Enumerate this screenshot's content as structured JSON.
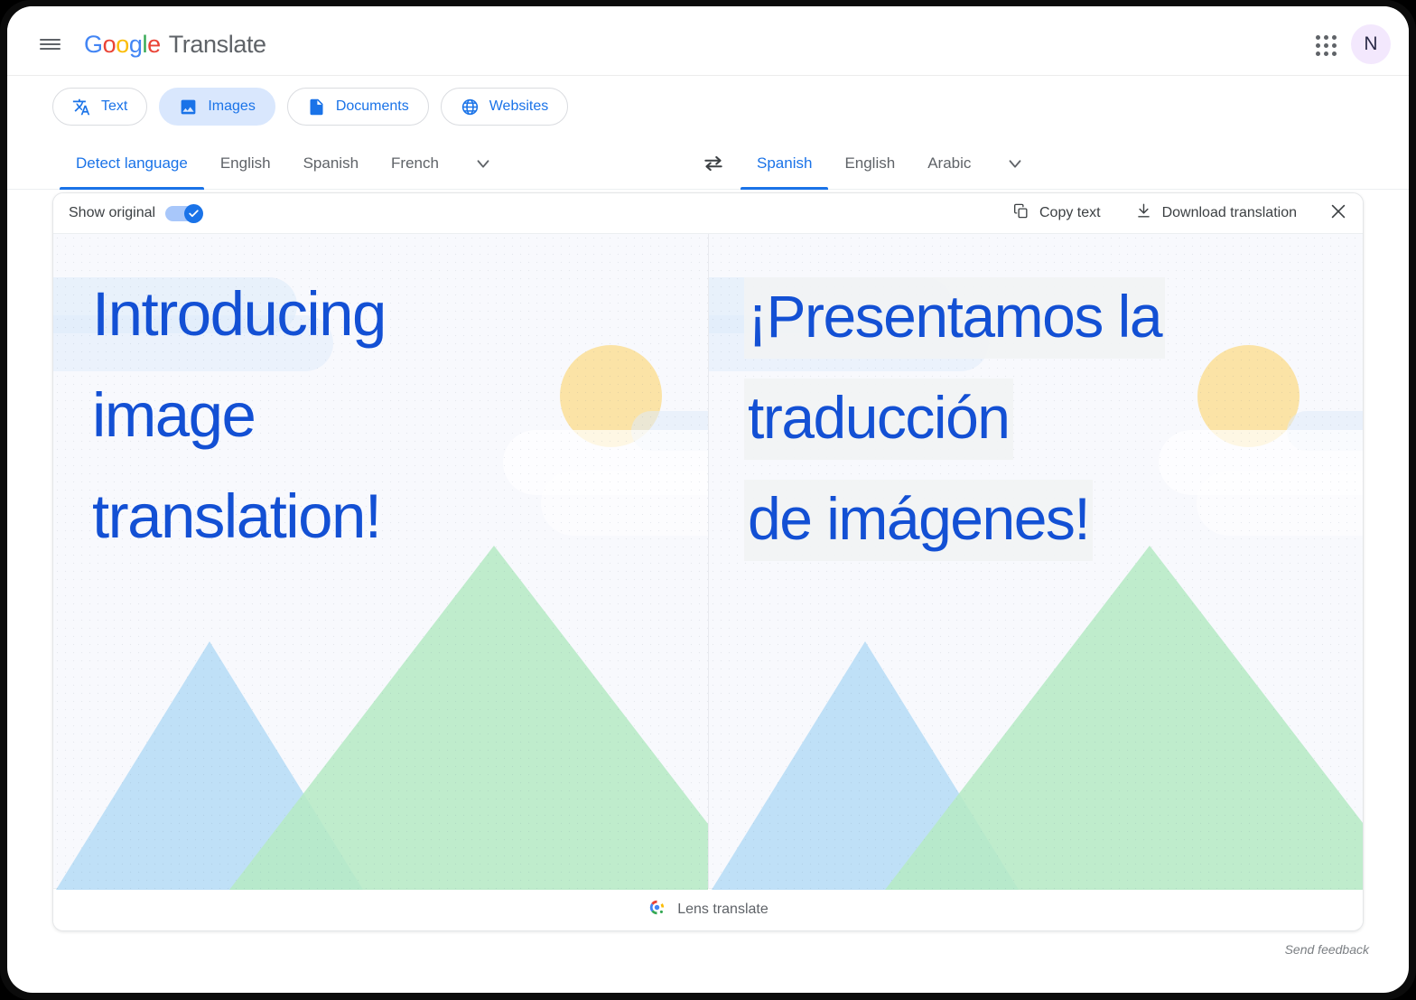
{
  "header": {
    "menu_icon": "hamburger-menu-icon",
    "brand_google": [
      "G",
      "o",
      "o",
      "g",
      "l",
      "e"
    ],
    "brand_product": "Translate",
    "apps_icon": "apps-grid-icon",
    "avatar_initial": "N"
  },
  "mode_tabs": [
    {
      "label": "Text",
      "icon": "translate-text-icon",
      "active": false
    },
    {
      "label": "Images",
      "icon": "image-icon",
      "active": true
    },
    {
      "label": "Documents",
      "icon": "document-icon",
      "active": false
    },
    {
      "label": "Websites",
      "icon": "globe-icon",
      "active": false
    }
  ],
  "source_languages": {
    "items": [
      "Detect language",
      "English",
      "Spanish",
      "French"
    ],
    "selected": "Detect language",
    "more_icon": "chevron-down-icon"
  },
  "swap": {
    "icon": "swap-languages-icon"
  },
  "target_languages": {
    "items": [
      "Spanish",
      "English",
      "Arabic"
    ],
    "selected": "Spanish",
    "more_icon": "chevron-down-icon"
  },
  "card_toolbar": {
    "show_original_label": "Show original",
    "show_original_on": true,
    "toggle_icon": "check-icon",
    "copy_text_label": "Copy text",
    "copy_text_icon": "copy-icon",
    "download_label": "Download translation",
    "download_icon": "download-icon",
    "close_icon": "close-icon"
  },
  "panels": {
    "original": {
      "name": "original-image",
      "lines": [
        "Introducing",
        "image",
        "translation!"
      ]
    },
    "translated": {
      "name": "translated-image",
      "lines": [
        "¡Presentamos la",
        "traducción",
        "de imágenes!"
      ]
    }
  },
  "lens_bar": {
    "label": "Lens translate",
    "icon": "google-lens-icon"
  },
  "footer": {
    "send_feedback": "Send feedback"
  },
  "colors": {
    "google_blue": "#4285F4",
    "google_red": "#EA4335",
    "google_yellow": "#FBBC05",
    "google_green": "#34A853",
    "accent_blue": "#1a73e8",
    "headline_blue": "#1350d4",
    "sun_yellow": "#fbe3a6",
    "mountain_blue": "#bfe0f7",
    "mountain_green": "#b6e9c5",
    "avatar_bg": "#f3e8fd"
  }
}
